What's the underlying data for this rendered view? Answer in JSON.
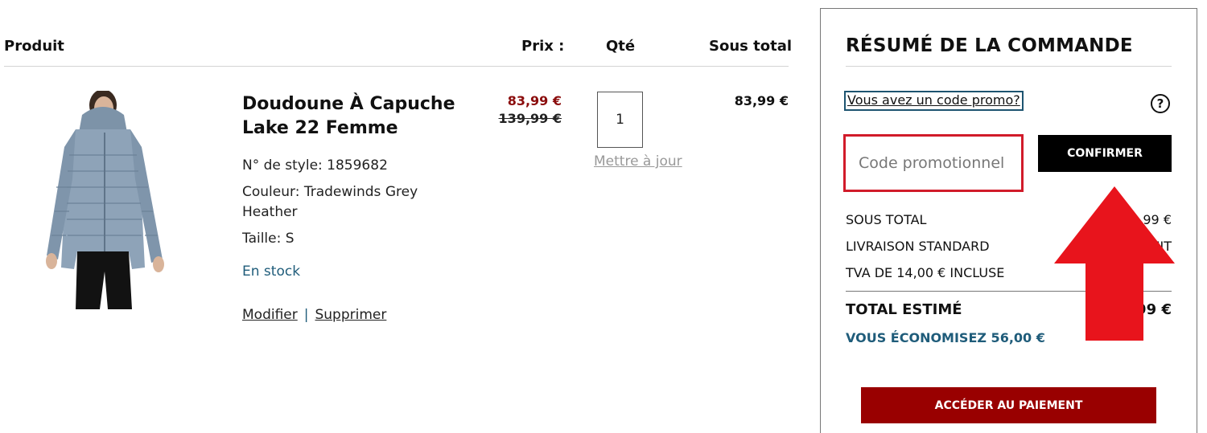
{
  "cart_header": {
    "product": "Produit",
    "price": "Prix :",
    "qty": "Qté",
    "subtotal": "Sous total"
  },
  "item": {
    "title": "Doudoune À Capuche Lake 22 Femme",
    "style": "N° de style: 1859682",
    "color": "Couleur: Tradewinds Grey Heather",
    "size": "Taille: S",
    "stock": "En stock",
    "edit_label": "Modifier",
    "separator": "|",
    "remove_label": "Supprimer",
    "sale_price": "83,99 €",
    "original_price": "139,99 €",
    "quantity": "1",
    "update_label": "Mettre à jour",
    "line_subtotal": "83,99 €"
  },
  "summary": {
    "title": "RÉSUMÉ DE LA COMMANDE",
    "promo_link": "Vous avez un code promo?",
    "help_icon": "question-circle-icon",
    "help_glyph": "?",
    "promo_placeholder": "Code promotionnel",
    "confirm_label": "CONFIRMER",
    "subtotal_label": "SOUS TOTAL",
    "subtotal_value": "3,99 €",
    "shipping_label": "LIVRAISON STANDARD",
    "shipping_value": "UIT",
    "vat_label": "TVA DE 14,00 € INCLUSE",
    "total_label": "TOTAL ESTIMÉ",
    "total_value": "99 €",
    "savings": "VOUS ÉCONOMISEZ 56,00 €",
    "checkout_label": "ACCÉDER AU PAIEMENT"
  },
  "colors": {
    "sale_red": "#8b0d0d",
    "link_blue": "#1f5c7a",
    "checkout_red": "#990000",
    "highlight_red": "#d11b2a",
    "arrow_red": "#e8141c"
  }
}
